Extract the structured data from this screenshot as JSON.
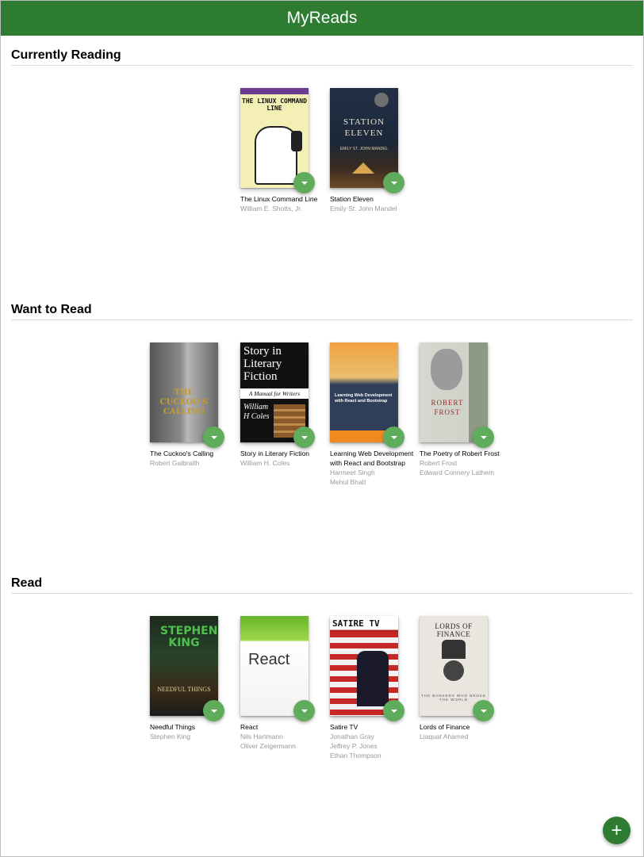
{
  "app": {
    "title": "MyReads"
  },
  "shelves": [
    {
      "title": "Currently Reading",
      "books": [
        {
          "title": "The Linux Command Line",
          "authors": [
            "William E. Shotts, Jr."
          ],
          "cover_text": "THE LINUX COMMAND LINE"
        },
        {
          "title": "Station Eleven",
          "authors": [
            "Emily St. John Mandel"
          ],
          "cover_text": "STATION ELEVEN",
          "cover_author": "EMILY ST. JOHN MANDEL"
        }
      ]
    },
    {
      "title": "Want to Read",
      "books": [
        {
          "title": "The Cuckoo's Calling",
          "authors": [
            "Robert Galbraith"
          ],
          "cover_text": "THE CUCKOO'S CALLING"
        },
        {
          "title": "Story in Literary Fiction",
          "authors": [
            "William H. Coles"
          ],
          "cover_text": "Story in Literary Fiction",
          "cover_sub": "A Manual for Writers",
          "cover_author": "William H Coles"
        },
        {
          "title": "Learning Web Development with React and Bootstrap",
          "authors": [
            "Harmeet Singh",
            "Mehul Bhatt"
          ],
          "cover_text": "Learning Web Development with React and Bootstrap"
        },
        {
          "title": "The Poetry of Robert Frost",
          "authors": [
            "Robert Frost",
            "Edward Connery Lathem"
          ],
          "cover_text": "ROBERT FROST"
        }
      ]
    },
    {
      "title": "Read",
      "books": [
        {
          "title": "Needful Things",
          "authors": [
            "Stephen King"
          ],
          "cover_text": "STEPHEN KING",
          "cover_sub": "NEEDFUL THINGS"
        },
        {
          "title": "React",
          "authors": [
            "Nils Hartmann",
            "Oliver Zeigermann"
          ],
          "cover_text": "React"
        },
        {
          "title": "Satire TV",
          "authors": [
            "Jonathan Gray",
            "Jeffrey P. Jones",
            "Ethan Thompson"
          ],
          "cover_text": "SATIRE TV"
        },
        {
          "title": "Lords of Finance",
          "authors": [
            "Liaquat Ahamed"
          ],
          "cover_text": "LORDS OF FINANCE",
          "cover_sub": "THE BANKERS WHO BROKE THE WORLD"
        }
      ]
    }
  ],
  "icons": {
    "shelf_changer": "chevron-down-icon",
    "add": "plus-icon"
  },
  "colors": {
    "header": "#2e7c31",
    "changer": "#60ac5d",
    "add_button": "#2e7c31"
  },
  "add_button": {
    "label": "+"
  }
}
